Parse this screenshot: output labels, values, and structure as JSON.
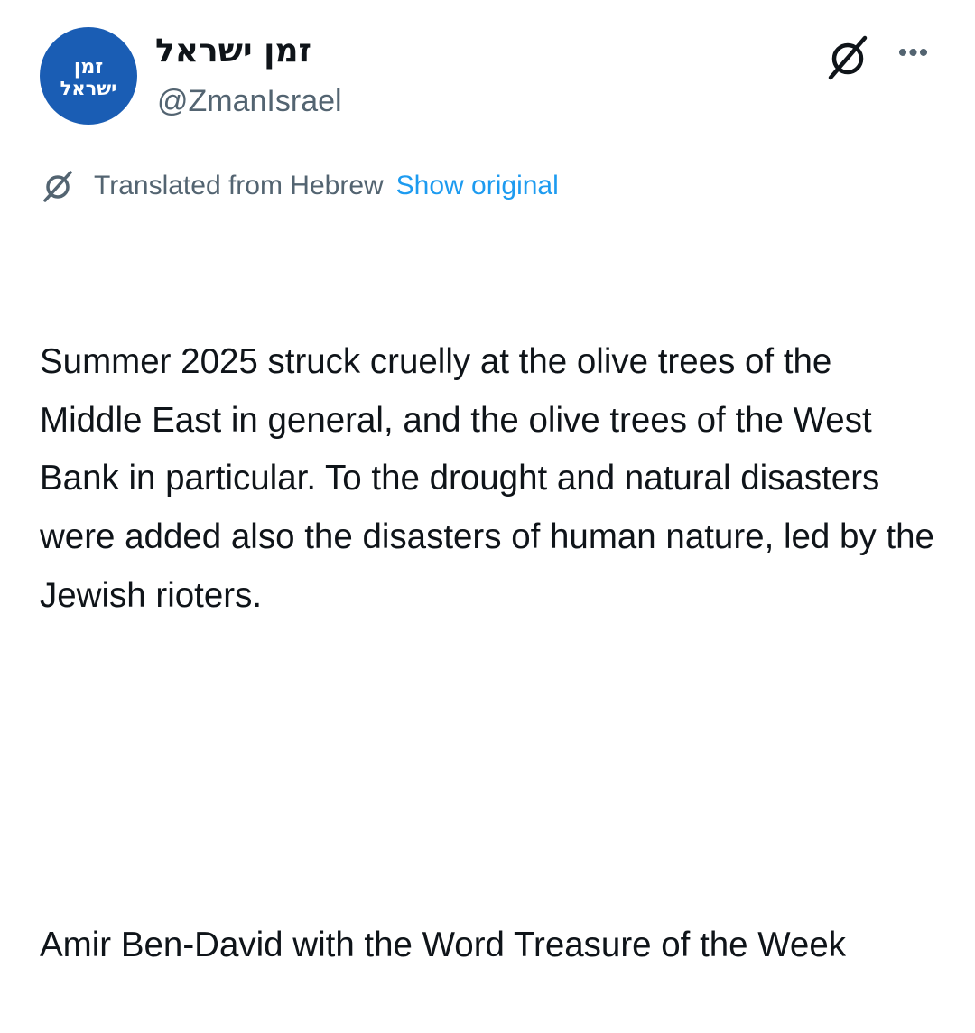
{
  "account": {
    "avatar_line1": "זמן",
    "avatar_line2": "ישראל",
    "display_name": "זמן ישראל",
    "handle": "@ZmanIsrael"
  },
  "icons": {
    "header_right": [
      "grok-icon",
      "more-icon"
    ],
    "translate": "grok-icon",
    "more_glyph": "•••"
  },
  "translation": {
    "label": "Translated from Hebrew",
    "link": "Show original"
  },
  "tweet": {
    "paragraph1": "Summer 2025 struck cruelly at the olive trees of the Middle East in general, and the olive trees of the West Bank in particular. To the drought and natural disasters were added also the disasters of human nature, led by the Jewish rioters.",
    "paragraph2": "Amir Ben-David with the Word Treasure of the Week"
  },
  "colors": {
    "text": "#0f1419",
    "secondary": "#536471",
    "link": "#1d9bf0",
    "avatar_bg": "#1a5db4"
  }
}
